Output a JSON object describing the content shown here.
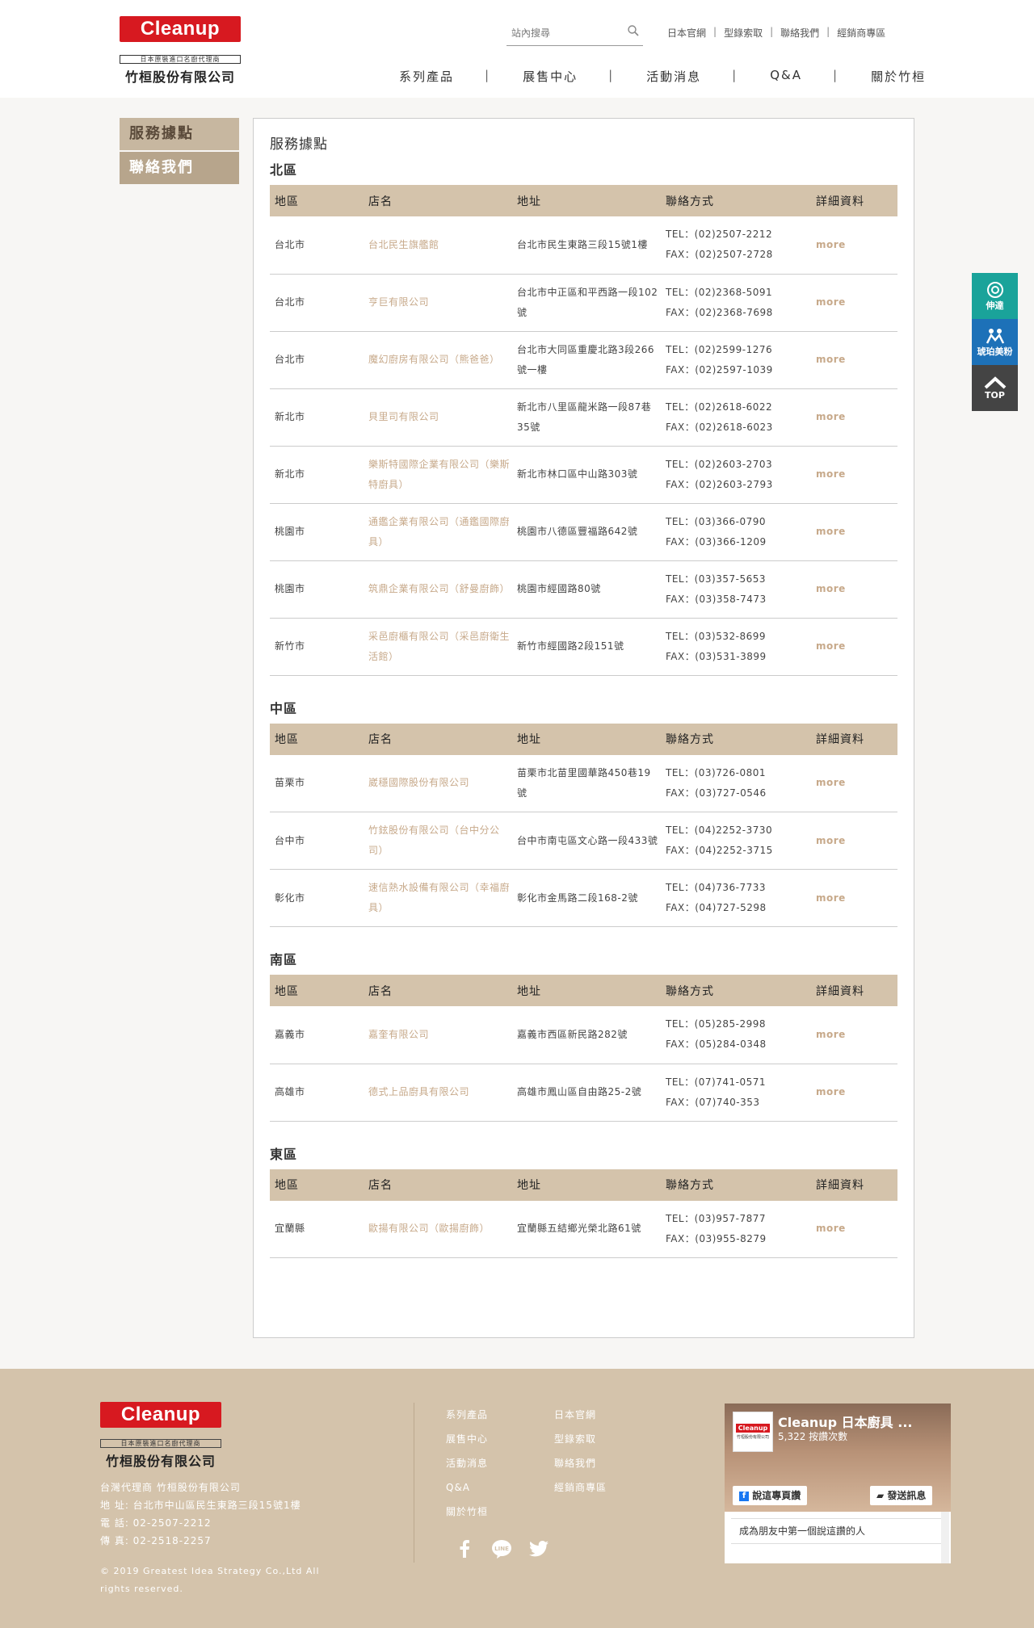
{
  "header": {
    "logo_text": "Cleanup",
    "logo_sub": "日本原裝進口名廚代理商",
    "logo_name": "竹桓股份有限公司",
    "search_placeholder": "站內搜尋",
    "toplinks": [
      "日本官網",
      "型錄索取",
      "聯絡我們",
      "經銷商專區"
    ],
    "nav": [
      "系列產品",
      "展售中心",
      "活動消息",
      "Q&A",
      "關於竹桓"
    ]
  },
  "sidebar": {
    "items": [
      "服務據點",
      "聯絡我們"
    ]
  },
  "panel": {
    "title": "服務據點"
  },
  "table_headers": [
    "地區",
    "店名",
    "地址",
    "聯絡方式",
    "詳細資料"
  ],
  "regions": [
    {
      "name": "北區",
      "rows": [
        {
          "area": "台北市",
          "shop": "台北民生旗艦館",
          "addr": "台北市民生東路三段15號1樓",
          "tel": "TEL：(02)2507-2212",
          "fax": "FAX：(02)2507-2728",
          "more": "more"
        },
        {
          "area": "台北市",
          "shop": "亨巨有限公司",
          "addr": "台北市中正區和平西路一段102號",
          "tel": "TEL：(02)2368-5091",
          "fax": "FAX：(02)2368-7698",
          "more": "more"
        },
        {
          "area": "台北市",
          "shop": "魔幻廚房有限公司（熊爸爸）",
          "addr": "台北市大同區重慶北路3段266號一樓",
          "tel": "TEL：(02)2599-1276",
          "fax": "FAX：(02)2597-1039",
          "more": "more"
        },
        {
          "area": "新北市",
          "shop": "貝里司有限公司",
          "addr": "新北市八里區龍米路一段87巷35號",
          "tel": "TEL：(02)2618-6022",
          "fax": "FAX：(02)2618-6023",
          "more": "more"
        },
        {
          "area": "新北市",
          "shop": "樂斯特國際企業有限公司（樂斯特廚具）",
          "addr": "新北市林口區中山路303號",
          "tel": "TEL：(02)2603-2703",
          "fax": "FAX：(02)2603-2793",
          "more": "more"
        },
        {
          "area": "桃園市",
          "shop": "通鑑企業有限公司（通鑑國際廚具）",
          "addr": "桃園市八德區豐福路642號",
          "tel": "TEL：(03)366-0790",
          "fax": "FAX：(03)366-1209",
          "more": "more"
        },
        {
          "area": "桃園市",
          "shop": "筑鼎企業有限公司（舒曼廚飾）",
          "addr": "桃園市經國路80號",
          "tel": "TEL：(03)357-5653",
          "fax": "FAX：(03)358-7473",
          "more": "more"
        },
        {
          "area": "新竹市",
          "shop": "采邑廚櫃有限公司（采邑廚衛生活館）",
          "addr": "新竹市經國路2段151號",
          "tel": "TEL：(03)532-8699",
          "fax": "FAX：(03)531-3899",
          "more": "more"
        }
      ]
    },
    {
      "name": "中區",
      "rows": [
        {
          "area": "苗栗市",
          "shop": "崴穩國際股份有限公司",
          "addr": "苗栗市北苗里國華路450巷19號",
          "tel": "TEL：(03)726-0801",
          "fax": "FAX：(03)727-0546",
          "more": "more"
        },
        {
          "area": "台中市",
          "shop": "竹鉉股份有限公司（台中分公司）",
          "addr": "台中市南屯區文心路一段433號",
          "tel": "TEL：(04)2252-3730",
          "fax": "FAX：(04)2252-3715",
          "more": "more"
        },
        {
          "area": "彰化市",
          "shop": "速信熱水設備有限公司（幸福廚具）",
          "addr": "彰化市金馬路二段168-2號",
          "tel": "TEL：(04)736-7733",
          "fax": "FAX：(04)727-5298",
          "more": "more"
        }
      ]
    },
    {
      "name": "南區",
      "rows": [
        {
          "area": "嘉義市",
          "shop": "嘉奎有限公司",
          "addr": "嘉義市西區新民路282號",
          "tel": "TEL：(05)285-2998",
          "fax": "FAX：(05)284-0348",
          "more": "more"
        },
        {
          "area": "高雄市",
          "shop": "德式上品廚具有限公司",
          "addr": "高雄市鳳山區自由路25-2號",
          "tel": "TEL：(07)741-0571",
          "fax": "FAX：(07)740-353",
          "more": "more"
        }
      ]
    },
    {
      "name": "東區",
      "rows": [
        {
          "area": "宜蘭縣",
          "shop": "歐揚有限公司（歐揚廚飾）",
          "addr": "宜蘭縣五結鄉光榮北路61號",
          "tel": "TEL：(03)957-7877",
          "fax": "FAX：(03)955-8279",
          "more": "more"
        }
      ]
    }
  ],
  "floater": {
    "items": [
      "伸達",
      "琥珀美粉",
      "TOP"
    ]
  },
  "footer": {
    "logo_text": "Cleanup",
    "logo_sub": "日本原裝進口名廚代理商",
    "logo_name": "竹桓股份有限公司",
    "info": [
      "台灣代理商 竹桓股份有限公司",
      "地 址: 台北市中山區民生東路三段15號1樓",
      "電 話: 02-2507-2212",
      "傳 真: 02-2518-2257"
    ],
    "copyright": "© 2019 Greatest Idea Strategy Co.,Ltd All rights reserved.",
    "col1": [
      "系列產品",
      "展售中心",
      "活動消息",
      "Q&A",
      "關於竹桓"
    ],
    "col2": [
      "日本官網",
      "型錄索取",
      "聯絡我們",
      "經銷商專區"
    ],
    "fb": {
      "page_name": "Cleanup 日本廚具 ...",
      "likes": "5,322 按讚次數",
      "like_button": "說這專頁讚",
      "message_button": "發送訊息",
      "friend_text": "成為朋友中第一個說這讚的人",
      "thumb_logo": "Cleanup",
      "thumb_sub": "竹桓股份有限公司"
    }
  }
}
